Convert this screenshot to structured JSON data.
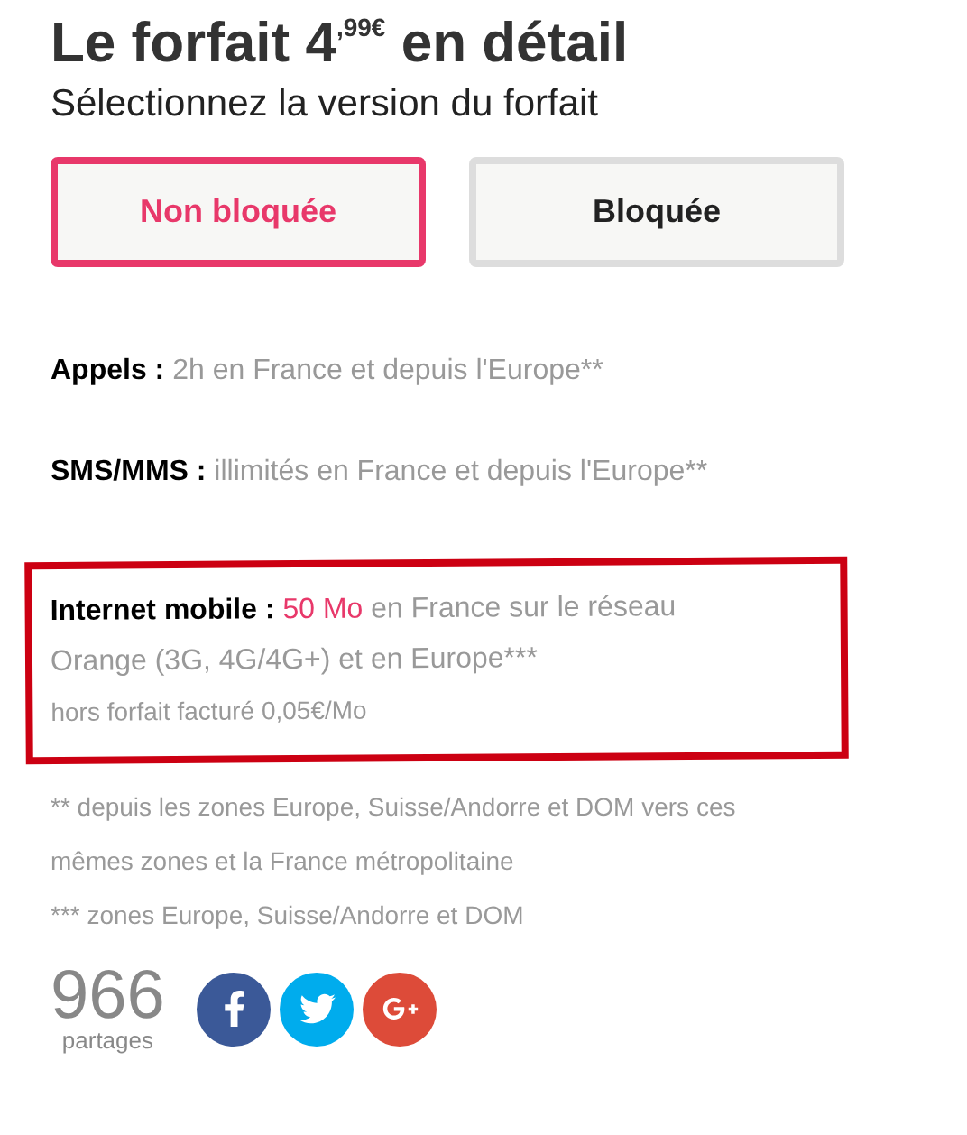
{
  "title": "Le forfait 4$^{,99€}$ en détail",
  "subtitle": "Sélectionnez la version du forfait",
  "versions": [
    {
      "label": "Non bloquée",
      "selected": true
    },
    {
      "label": "Bloquée",
      "selected": false
    }
  ],
  "features": [
    {
      "label": "Appels :",
      "parts": [
        {
          "text": "2h en France et depuis l'Europe**",
          "highlight": false
        }
      ],
      "circled": false
    },
    {
      "label": "SMS/MMS :",
      "parts": [
        {
          "text": "illimités en France et depuis l'Europe**",
          "highlight": false
        }
      ],
      "circled": false
    },
    {
      "label": "Internet mobile :",
      "parts": [
        {
          "text": "50 Mo",
          "highlight": true
        },
        {
          "text": "en France sur le réseau Orange (3G, 4G/4G+) et en Europe***",
          "highlight": false
        }
      ],
      "note": "hors forfait facturé 0,05€/Mo",
      "circled": true
    }
  ],
  "footnotes": [
    "** depuis les zones Europe, Suisse/Andorre et DOM vers ces mêmes zones et la France métropolitaine",
    "*** zones Europe, Suisse/Andorre et DOM"
  ],
  "shares": {
    "count": "966",
    "label": "partages",
    "buttons": [
      {
        "kind": "facebook"
      },
      {
        "kind": "twitter"
      },
      {
        "kind": "googleplus"
      }
    ]
  }
}
